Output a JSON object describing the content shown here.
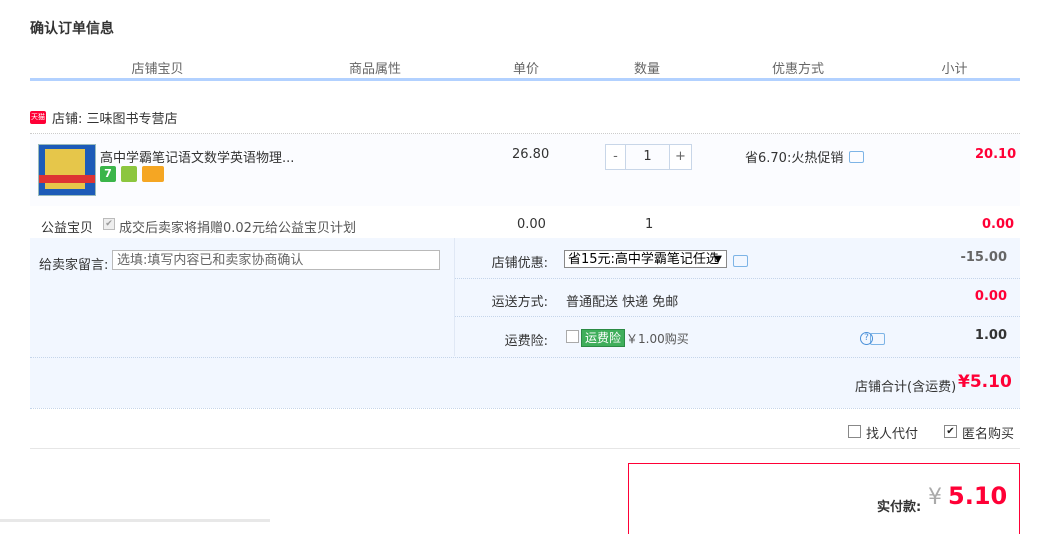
{
  "page": {
    "title": "确认订单信息"
  },
  "table_headers": [
    "店铺宝贝",
    "商品属性",
    "单价",
    "数量",
    "优惠方式",
    "小计"
  ],
  "store": {
    "badge": "天猫",
    "label": "店铺: 三味图书专营店"
  },
  "item": {
    "name": "高中学霸笔记语文数学英语物理...",
    "price": "26.80",
    "quantity": "1",
    "minus": "-",
    "plus": "+",
    "promo": "省6.70:火热促销",
    "subtotal": "20.10",
    "services": [
      "7-day-return-icon",
      "guarantee-icon",
      "credit-card-icon"
    ],
    "thumb_caption": "高中学霸笔记"
  },
  "charity": {
    "label": "公益宝贝",
    "text": "成交后卖家将捐赠0.02元给公益宝贝计划",
    "price": "0.00",
    "quantity": "1",
    "subtotal": "0.00"
  },
  "message": {
    "label": "给卖家留言:",
    "placeholder": "选填:填写内容已和卖家协商确认"
  },
  "store_discount": {
    "label": "店铺优惠:",
    "selected": "省15元:高中学霸笔记任选",
    "value": "-15.00"
  },
  "shipping": {
    "label": "运送方式:",
    "method": "普通配送 快递 免邮",
    "value": "0.00"
  },
  "insurance": {
    "label": "运费险:",
    "badge": "运费险",
    "text": "￥1.00购买",
    "value": "1.00",
    "help": "?"
  },
  "store_total": {
    "label": "店铺合计(含运费)",
    "value": "¥5.10"
  },
  "options": {
    "proxy_pay": "找人代付",
    "anonymous": "匿名购买",
    "anonymous_checked": true,
    "proxy_checked": false
  },
  "payment": {
    "label": "实付款:",
    "currency": "¥",
    "amount": "5.10"
  },
  "colors": {
    "accent_red": "#ff0036",
    "header_underline": "#b2d1ff",
    "panel_bg": "#f2f7ff",
    "insurance_green": "#3fae5b"
  }
}
